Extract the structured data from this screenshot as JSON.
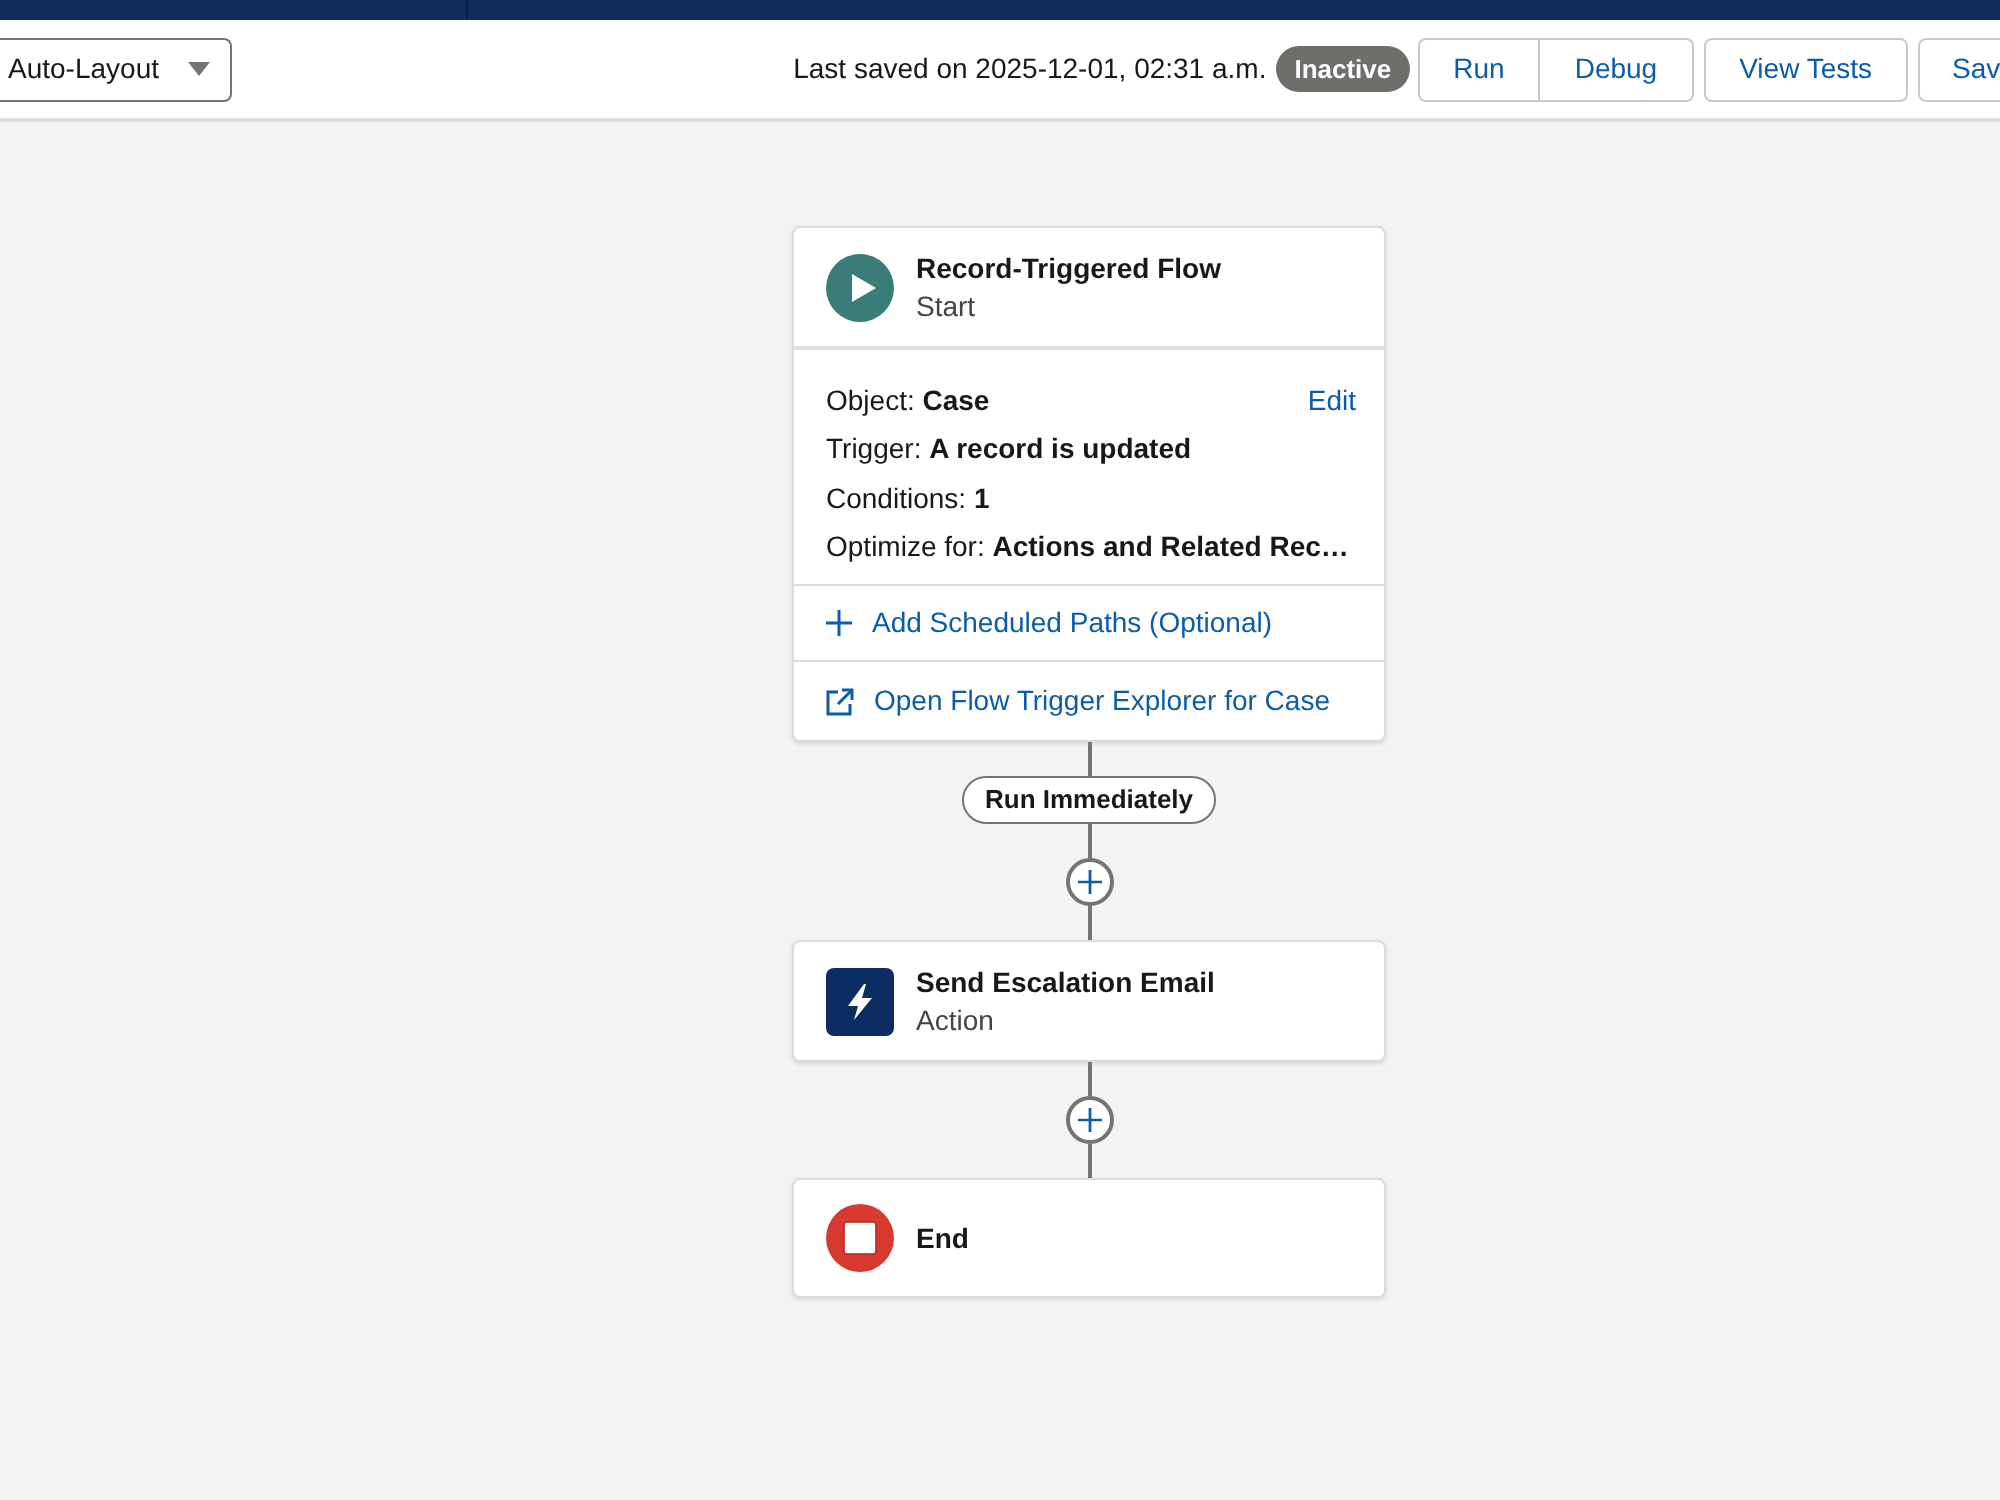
{
  "toolbar": {
    "layout_dropdown": {
      "value": "Auto-Layout"
    },
    "last_saved": "Last saved on 2025-12-01, 02:31 a.m.",
    "status_badge": "Inactive",
    "button_groups": [
      [
        "Run",
        "Debug"
      ],
      [
        "View Tests"
      ],
      [
        "Sav"
      ]
    ]
  },
  "flow": [
    {
      "kind": "start",
      "title": "Record-Triggered Flow",
      "subtitle": "Start",
      "details": [
        "Object: **Case**",
        "Trigger: **A record is updated**",
        "Conditions: **1**",
        "Optimize for: **Actions and Related Rec…**"
      ],
      "edit_link": "Edit",
      "links": [
        {
          "kind": "add",
          "label": "Add Scheduled Paths (Optional)"
        },
        {
          "kind": "external",
          "label": "Open Flow Trigger Explorer for Case"
        }
      ]
    },
    {
      "kind": "path_label",
      "label": "Run Immediately"
    },
    {
      "kind": "add_button"
    },
    {
      "kind": "action",
      "title": "Send Escalation Email",
      "subtitle": "Action"
    },
    {
      "kind": "add_button"
    },
    {
      "kind": "end",
      "title": "End"
    }
  ]
}
